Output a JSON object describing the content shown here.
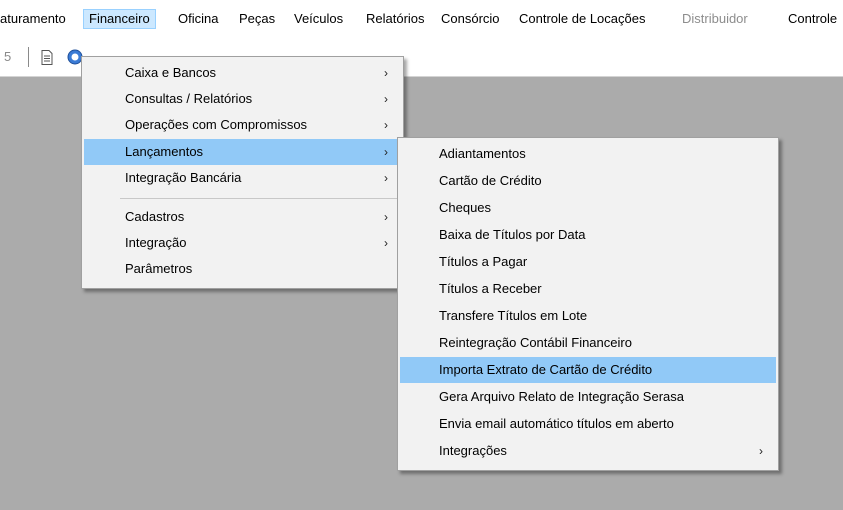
{
  "menubar": {
    "items": [
      {
        "label": "aturamento"
      },
      {
        "label": "Financeiro"
      },
      {
        "label": "Oficina"
      },
      {
        "label": "Peças"
      },
      {
        "label": "Veículos"
      },
      {
        "label": "Relatórios"
      },
      {
        "label": "Consórcio"
      },
      {
        "label": "Controle de Locações"
      },
      {
        "label": "Distribuidor"
      },
      {
        "label": "Controle"
      }
    ]
  },
  "toolbar": {
    "number": "5"
  },
  "financeiro_menu": {
    "items": [
      {
        "label": "Caixa e Bancos"
      },
      {
        "label": "Consultas / Relatórios"
      },
      {
        "label": "Operações com Compromissos"
      },
      {
        "label": "Lançamentos"
      },
      {
        "label": "Integração Bancária"
      },
      {
        "label": "Cadastros"
      },
      {
        "label": "Integração"
      },
      {
        "label": "Parâmetros"
      }
    ]
  },
  "lancamentos_menu": {
    "items": [
      {
        "label": "Adiantamentos"
      },
      {
        "label": "Cartão de Crédito"
      },
      {
        "label": "Cheques"
      },
      {
        "label": "Baixa de Títulos por Data"
      },
      {
        "label": "Títulos a Pagar"
      },
      {
        "label": "Títulos a Receber"
      },
      {
        "label": "Transfere Títulos em Lote"
      },
      {
        "label": "Reintegração Contábil Financeiro"
      },
      {
        "label": "Importa Extrato de Cartão de Crédito"
      },
      {
        "label": "Gera Arquivo Relato de Integração Serasa"
      },
      {
        "label": "Envia email automático títulos em aberto"
      },
      {
        "label": "Integrações"
      }
    ]
  },
  "colors": {
    "menu_highlight": "#91c9f7",
    "menubar_active": "#cce8ff",
    "workspace": "#ababab"
  }
}
